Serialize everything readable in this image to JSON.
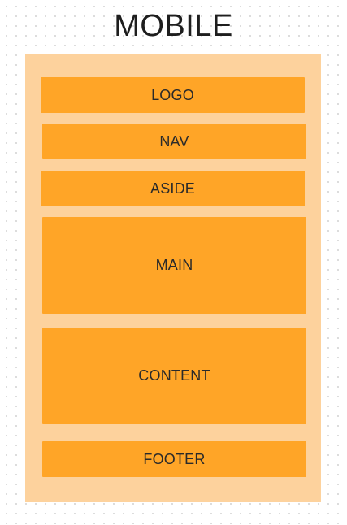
{
  "title": "MOBILE",
  "colors": {
    "frame": "#fdd29d",
    "block": "#ffa527",
    "text": "#1e1e1e"
  },
  "blocks": [
    {
      "label": "LOGO"
    },
    {
      "label": "NAV"
    },
    {
      "label": "ASIDE"
    },
    {
      "label": "MAIN"
    },
    {
      "label": "CONTENT"
    },
    {
      "label": "FOOTER"
    }
  ]
}
